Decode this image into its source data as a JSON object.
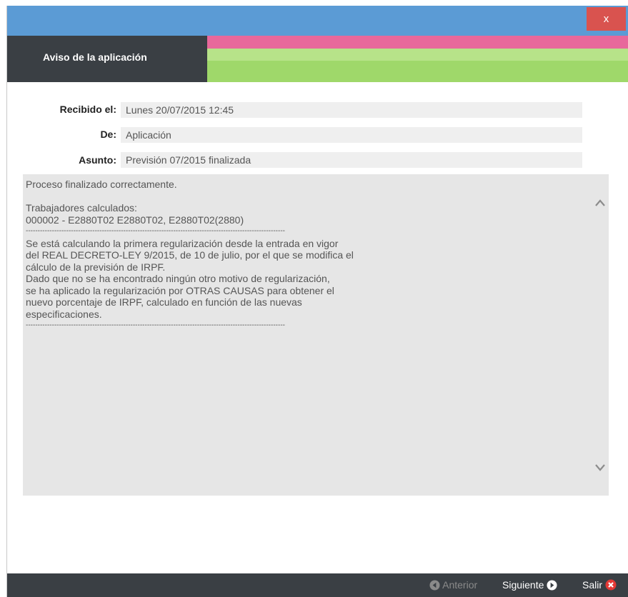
{
  "window": {
    "close_label": "x"
  },
  "header": {
    "title": "Aviso de la aplicación"
  },
  "fields": {
    "received": {
      "label": "Recibido el:",
      "value": "Lunes 20/07/2015 12:45"
    },
    "from": {
      "label": "De:",
      "value": "Aplicación"
    },
    "subject": {
      "label": "Asunto:",
      "value": "Previsión 07/2015 finalizada"
    }
  },
  "message": {
    "lines": [
      "Proceso finalizado correctamente.",
      "",
      "Trabajadores calculados:",
      "000002 - E2880T02 E2880T02, E2880T02(2880)",
      "-------------------------------------------------------------------------------------------------------------",
      "Se está calculando la primera regularización desde la entrada en vigor",
      "del REAL DECRETO-LEY 9/2015, de 10 de julio, por el que se modifica el",
      "cálculo de la previsión de IRPF.",
      "Dado que no se ha encontrado ningún otro motivo de regularización,",
      "se ha aplicado la regularización por OTRAS CAUSAS para obtener el",
      "nuevo porcentaje de IRPF, calculado en función de las nuevas",
      "especificaciones.",
      "-------------------------------------------------------------------------------------------------------------"
    ]
  },
  "footer": {
    "prev_label": "Anterior",
    "next_label": "Siguiente",
    "exit_label": "Salir"
  },
  "icons": {
    "close": "close-icon",
    "scroll_up": "chevron-up-icon",
    "scroll_down": "chevron-down-icon",
    "prev": "arrow-left-circle-icon",
    "next": "arrow-right-circle-icon",
    "exit": "close-circle-icon"
  },
  "colors": {
    "titlebar": "#5b9bd5",
    "close": "#d9534f",
    "header_dark": "#3a3f44",
    "stripe_pink": "#e8689b",
    "stripe_lightgreen": "#b7e389",
    "stripe_green": "#9fd86a",
    "footer": "#3a3f44"
  }
}
